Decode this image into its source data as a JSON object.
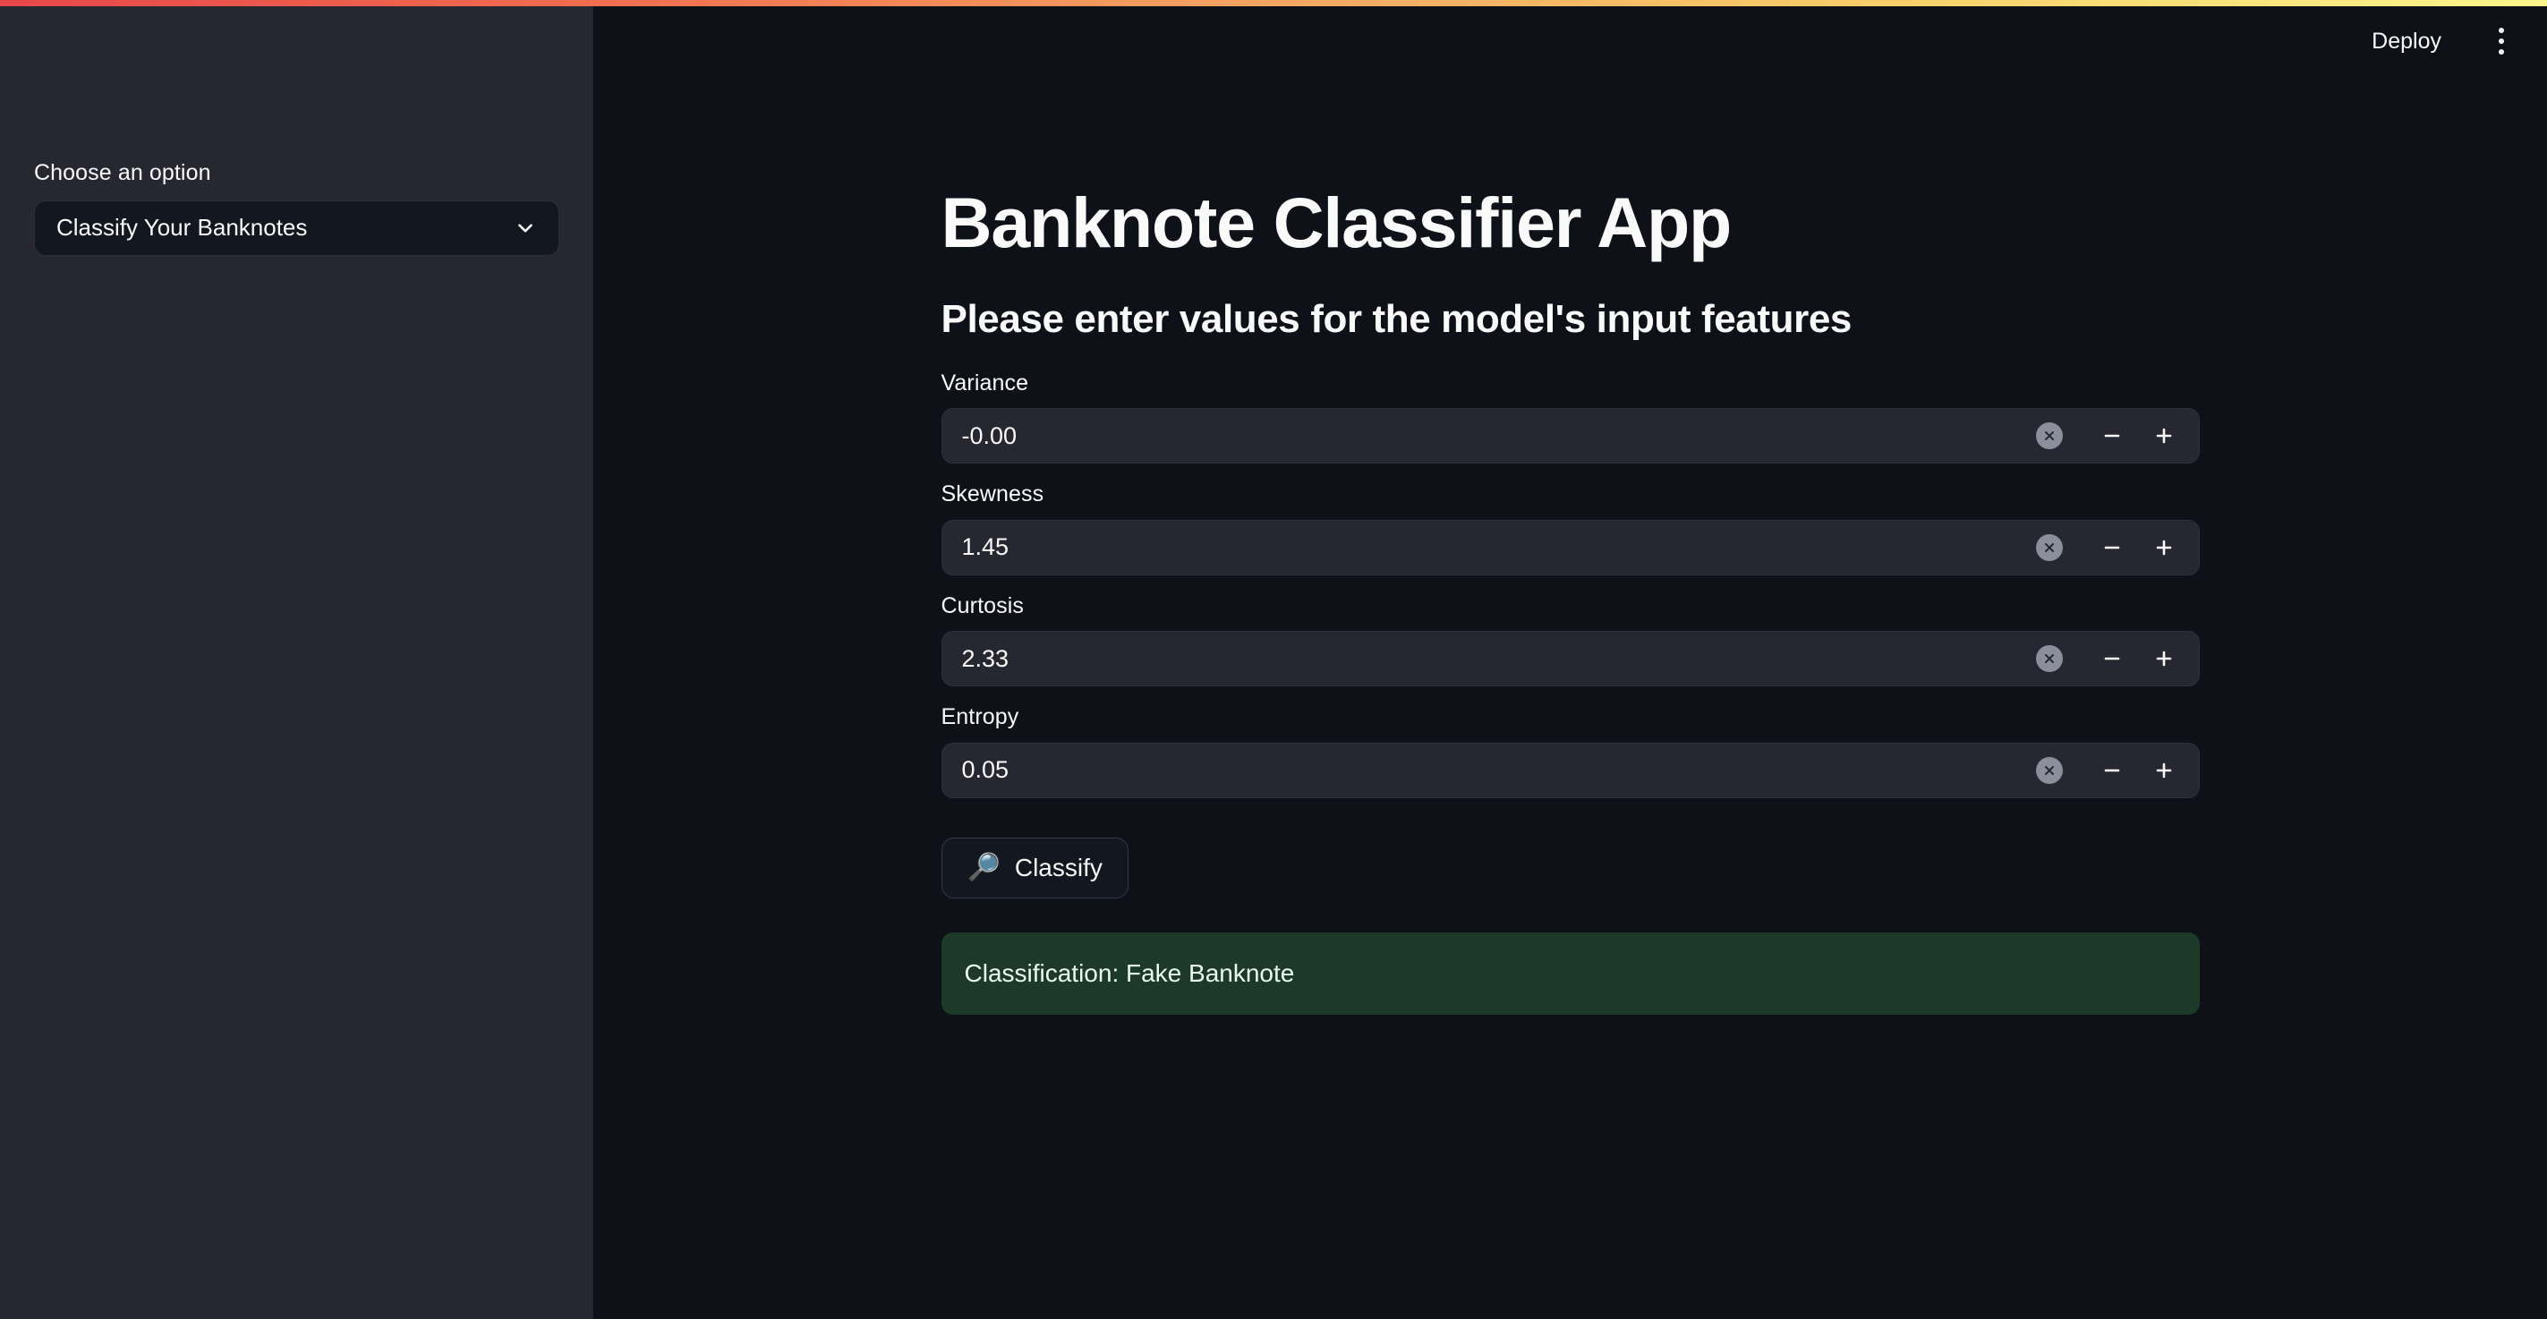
{
  "theme": {
    "app_background": "#0e1117",
    "sidebar_background": "#262730",
    "widget_background": "#262730",
    "text_color": "#fafafa",
    "success_background": "#1d3a29",
    "success_text": "#e9fbef",
    "gradient_start": "#e8474b",
    "gradient_mid": "#f4a261",
    "gradient_end": "#faf68c"
  },
  "header": {
    "deploy_label": "Deploy",
    "menu_icon": "kebab-menu-icon"
  },
  "sidebar": {
    "select_label": "Choose an option",
    "select_value": "Classify Your Banknotes",
    "select_icon": "chevron-down-icon"
  },
  "main": {
    "title": "Banknote Classifier App",
    "subtitle": "Please enter values for the model's input features",
    "fields": [
      {
        "label": "Variance",
        "value": "-0.00"
      },
      {
        "label": "Skewness",
        "value": "1.45"
      },
      {
        "label": "Curtosis",
        "value": "2.33"
      },
      {
        "label": "Entropy",
        "value": "0.05"
      }
    ],
    "field_icons": {
      "clear": "clear-circle-icon",
      "decrement": "minus-icon",
      "increment": "plus-icon"
    },
    "classify_button": {
      "emoji": "🔎",
      "icon_name": "magnifying-glass-icon",
      "label": "Classify"
    },
    "result": {
      "text": "Classification: Fake Banknote",
      "status": "success"
    }
  }
}
